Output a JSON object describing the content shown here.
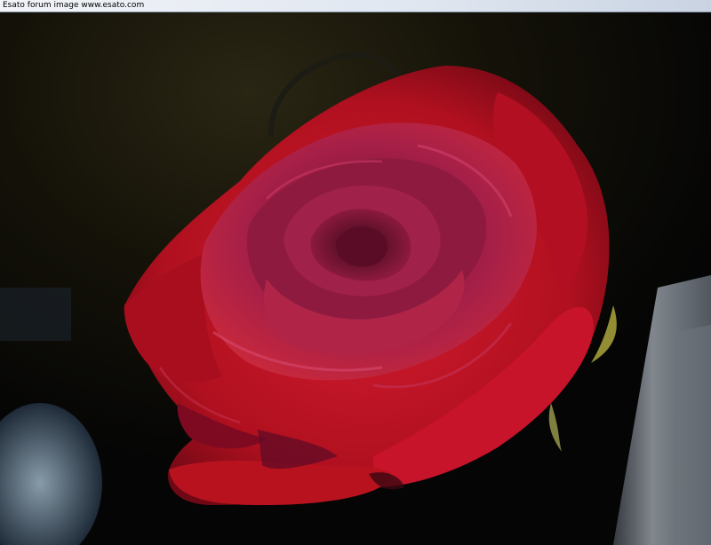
{
  "caption": {
    "text": "Esato forum image www.esato.com"
  },
  "photo": {
    "subject": "red-rose",
    "colors": {
      "petal_main": "#c8102e",
      "petal_dark": "#7a0a1c",
      "petal_inner": "#9e1e4a",
      "background": "#0a0a0a"
    }
  }
}
